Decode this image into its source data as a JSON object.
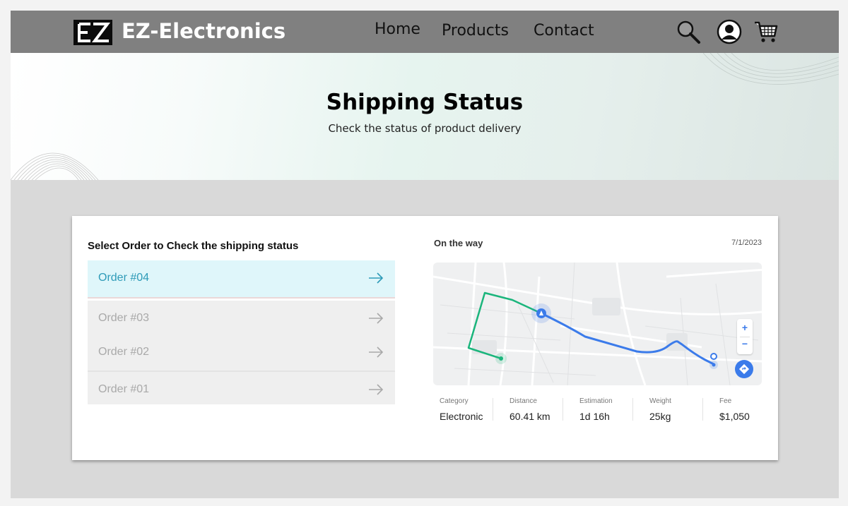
{
  "header": {
    "brand": "EZ-Electronics",
    "nav": {
      "home": "Home",
      "products": "Products",
      "contact": "Contact"
    },
    "icons": [
      "search-icon",
      "user-icon",
      "cart-icon"
    ]
  },
  "hero": {
    "title": "Shipping Status",
    "subtitle": "Check the status of product delivery"
  },
  "orders_panel": {
    "label": "Select Order to Check the shipping  status",
    "orders": [
      {
        "label": "Order #04",
        "active": true
      },
      {
        "label": "Order #03",
        "active": false
      },
      {
        "label": "Order #02",
        "active": false
      },
      {
        "label": "Order #01",
        "active": false
      }
    ]
  },
  "shipping": {
    "status": "On the way",
    "date": "7/1/2023",
    "map_controls": {
      "zoom_in": "+",
      "zoom_out": "−"
    },
    "stats": [
      {
        "label": "Category",
        "value": "Electronic"
      },
      {
        "label": "Distance",
        "value": "60.41 km"
      },
      {
        "label": "Estimation",
        "value": "1d 16h"
      },
      {
        "label": "Weight",
        "value": "25kg"
      },
      {
        "label": "Fee",
        "value": "$1,050"
      }
    ]
  },
  "colors": {
    "header_bg": "#808080",
    "active_order_bg": "#dff6fa",
    "active_order_text": "#2e9bb8",
    "route_blue": "#3b7bea",
    "route_green": "#1bb57c"
  }
}
